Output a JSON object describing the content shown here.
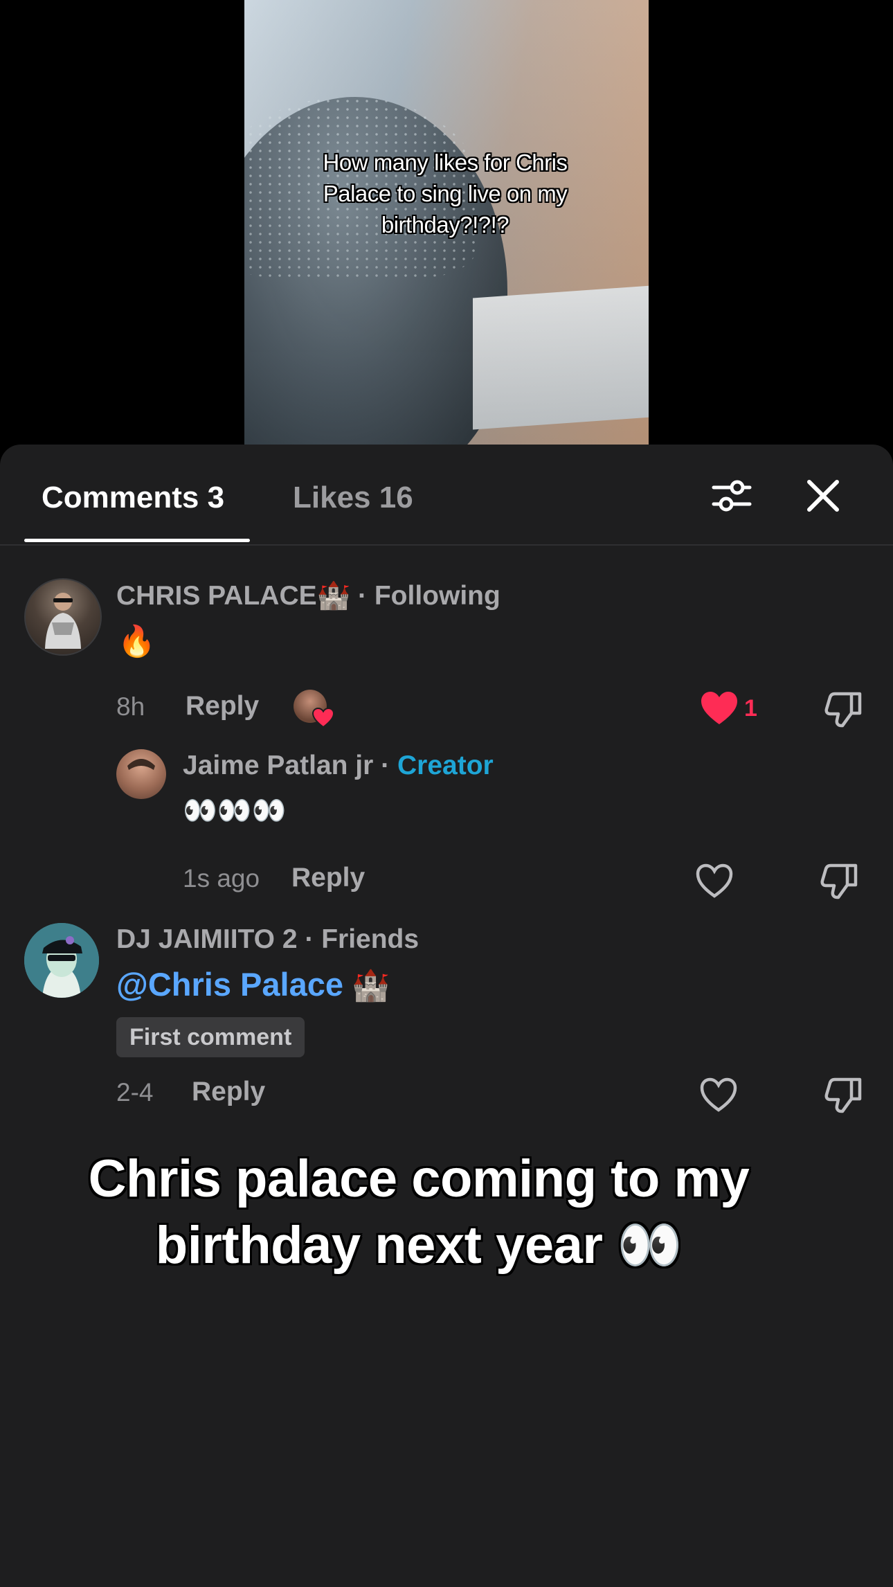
{
  "video": {
    "caption": "How many likes for Chris Palace to sing live on my birthday?!?!?"
  },
  "tabs": {
    "comments": "Comments 3",
    "likes": "Likes 16"
  },
  "icons": {
    "filter": "filter-sliders-icon",
    "close": "close-icon",
    "heart": "heart-icon",
    "dislike": "thumbs-down-icon"
  },
  "colors": {
    "panel_bg": "#1e1e1f",
    "liked": "#fe2c55",
    "creator": "#1ea5d6",
    "mention": "#5aa7ff"
  },
  "comments": [
    {
      "username": "CHRIS PALACE🏰",
      "relation": "Following",
      "text": "🔥",
      "time": "8h",
      "reply_label": "Reply",
      "likes": "1",
      "liked": true,
      "replies": [
        {
          "username": "Jaime Patlan jr",
          "relation": "Creator",
          "text": "👀👀👀",
          "time": "1s ago",
          "reply_label": "Reply"
        }
      ]
    },
    {
      "username": "DJ JAIMIITO 2",
      "relation": "Friends",
      "mention": "@Chris Palace",
      "mention_emoji": "🏰",
      "badge": "First comment",
      "time": "2-4",
      "reply_label": "Reply"
    }
  ],
  "overlay_text": "Chris palace coming to my birthday next year 👀"
}
